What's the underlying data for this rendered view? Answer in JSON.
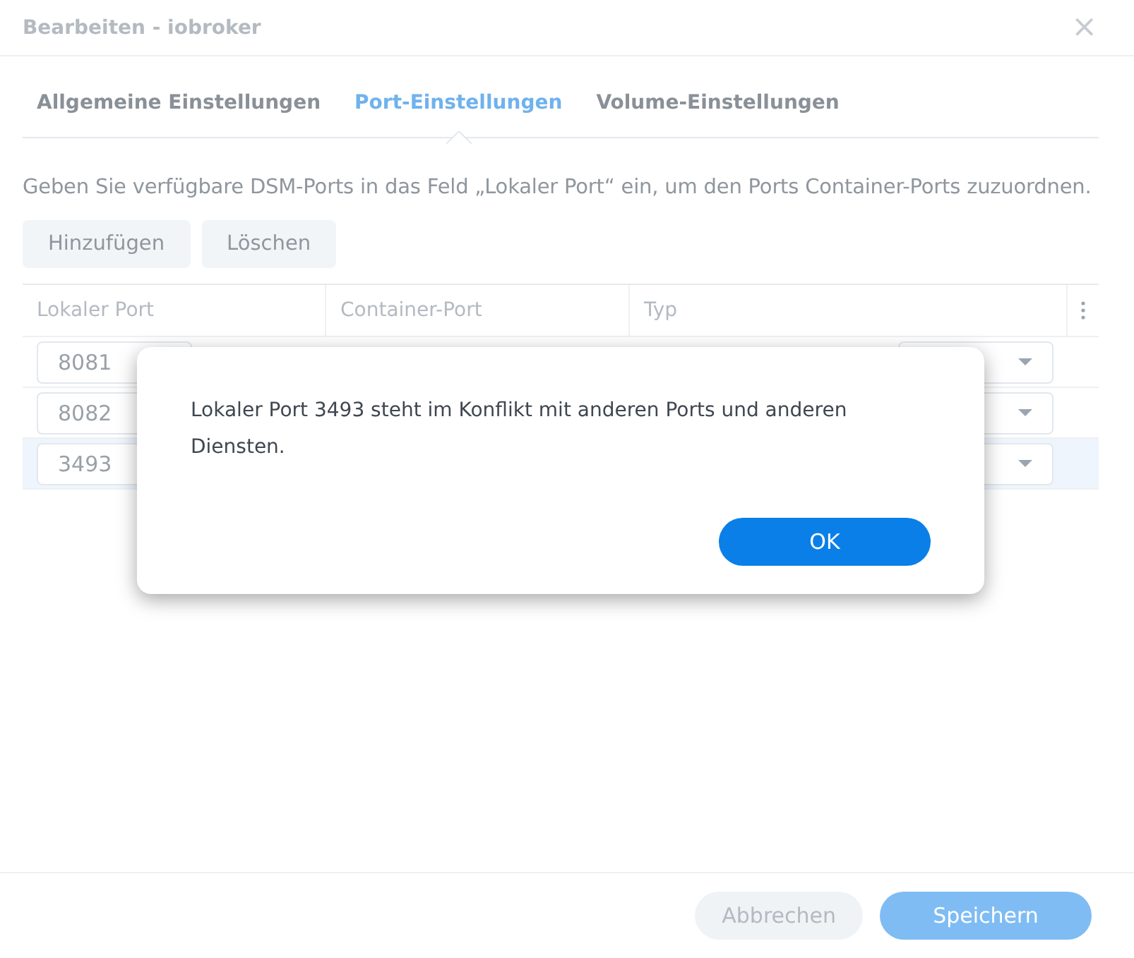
{
  "window": {
    "title": "Bearbeiten - iobroker",
    "close": "×"
  },
  "tabs": [
    {
      "label": "Allgemeine Einstellungen",
      "selected": false
    },
    {
      "label": "Port-Einstellungen",
      "selected": true
    },
    {
      "label": "Volume-Einstellungen",
      "selected": false
    }
  ],
  "description": "Geben Sie verfügbare DSM-Ports in das Feld „Lokaler Port“ ein, um den Ports Container-Ports zuzuordnen.",
  "toolbar": [
    "Hinzufügen",
    "Löschen"
  ],
  "table": {
    "columns": [
      "Lokaler Port",
      "Container-Port",
      "Typ"
    ],
    "rows": [
      {
        "local_port": "8081",
        "selected": false
      },
      {
        "local_port": "8082",
        "selected": false
      },
      {
        "local_port": "3493",
        "selected": true
      }
    ]
  },
  "alert": {
    "message": "Lokaler Port 3493 steht im Konflikt mit anderen Ports und anderen Diensten.",
    "button": "OK"
  },
  "footer": [
    {
      "label": "Abbrechen",
      "kind": "secondary",
      "disabled": true
    },
    {
      "label": "Speichern",
      "kind": "primary",
      "disabled": true
    }
  ]
}
